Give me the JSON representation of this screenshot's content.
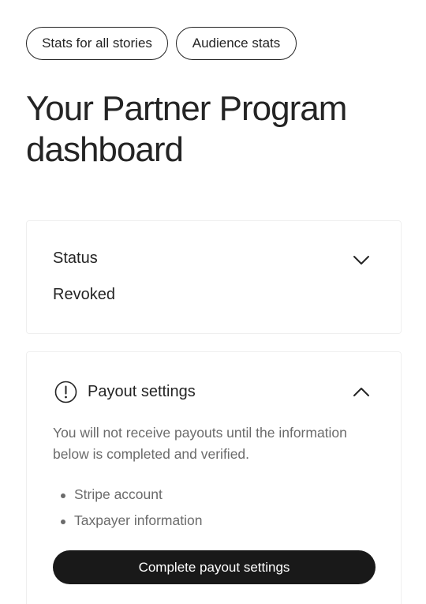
{
  "tabs": [
    {
      "label": "Stats for all stories"
    },
    {
      "label": "Audience stats"
    }
  ],
  "page_title": "Your Partner Program dashboard",
  "status_card": {
    "heading": "Status",
    "value": "Revoked",
    "toggle_icon": "chevron-down-icon"
  },
  "payout_card": {
    "icon": "alert-circle-icon",
    "heading": "Payout settings",
    "toggle_icon": "chevron-up-icon",
    "description": "You will not receive payouts until the information below is completed and verified.",
    "requirements": [
      "Stripe account",
      "Taxpayer information"
    ],
    "button_label": "Complete payout settings"
  },
  "colors": {
    "text": "#242424",
    "muted_text": "#6b6b6b",
    "button_bg": "#191919",
    "card_border": "#efefef"
  }
}
